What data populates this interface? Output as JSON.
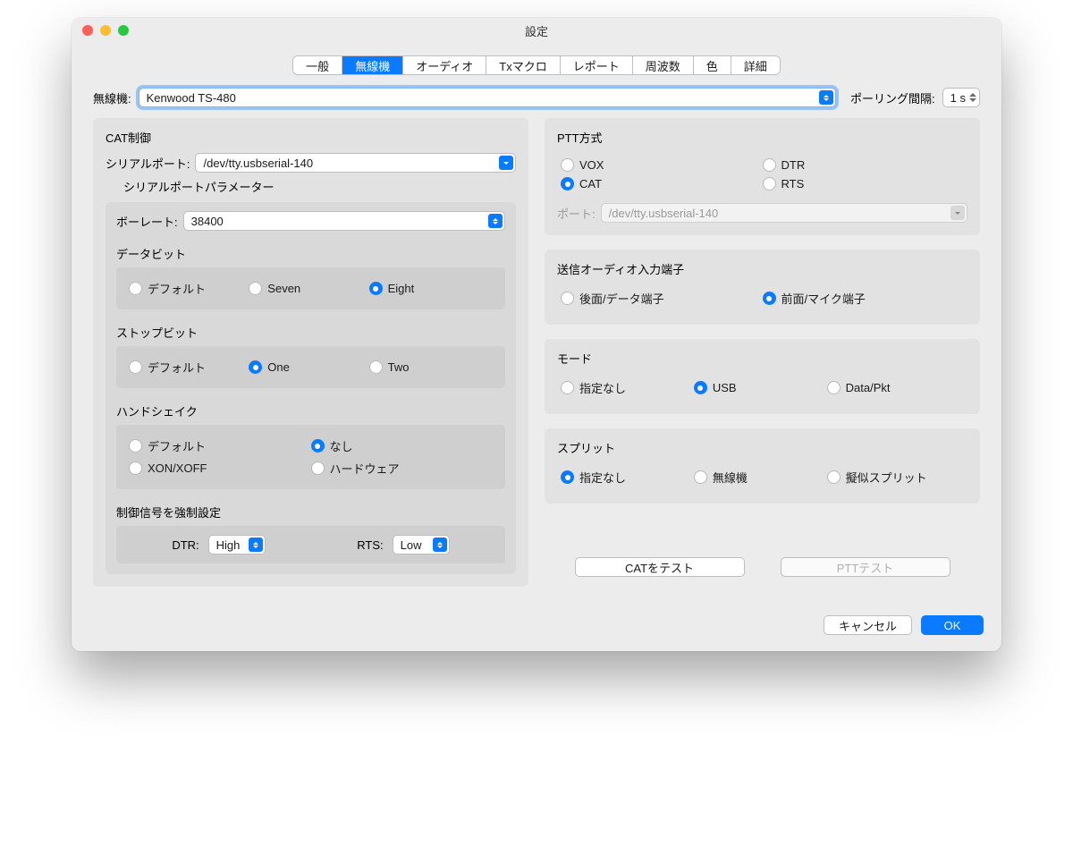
{
  "window_title": "設定",
  "tabs": [
    "一般",
    "無線機",
    "オーディオ",
    "Txマクロ",
    "レポート",
    "周波数",
    "色",
    "詳細"
  ],
  "active_tab": "無線機",
  "rig_label": "無線機:",
  "rig_value": "Kenwood TS-480",
  "poll_label": "ポーリング間隔:",
  "poll_value": "1 s",
  "cat": {
    "title": "CAT制御",
    "serial_label": "シリアルポート:",
    "serial_value": "/dev/tty.usbserial-140",
    "params_title": "シリアルポートパラメーター",
    "baud_label": "ボーレート:",
    "baud_value": "38400",
    "databits_title": "データビット",
    "databits": [
      "デフォルト",
      "Seven",
      "Eight"
    ],
    "databits_sel": "Eight",
    "stopbits_title": "ストップビット",
    "stopbits": [
      "デフォルト",
      "One",
      "Two"
    ],
    "stopbits_sel": "One",
    "handshake_title": "ハンドシェイク",
    "handshake": [
      "デフォルト",
      "なし",
      "XON/XOFF",
      "ハードウェア"
    ],
    "handshake_sel": "なし",
    "force_title": "制御信号を強制設定",
    "dtr_label": "DTR:",
    "dtr_value": "High",
    "rts_label": "RTS:",
    "rts_value": "Low"
  },
  "ptt": {
    "title": "PTT方式",
    "options": [
      "VOX",
      "CAT",
      "DTR",
      "RTS"
    ],
    "selected": "CAT",
    "port_label": "ポート:",
    "port_value": "/dev/tty.usbserial-140"
  },
  "txaudio": {
    "title": "送信オーディオ入力端子",
    "options": [
      "後面/データ端子",
      "前面/マイク端子"
    ],
    "selected": "前面/マイク端子"
  },
  "mode": {
    "title": "モード",
    "options": [
      "指定なし",
      "USB",
      "Data/Pkt"
    ],
    "selected": "USB"
  },
  "split": {
    "title": "スプリット",
    "options": [
      "指定なし",
      "無線機",
      "擬似スプリット"
    ],
    "selected": "指定なし"
  },
  "buttons": {
    "cat_test": "CATをテスト",
    "ptt_test": "PTTテスト",
    "cancel": "キャンセル",
    "ok": "OK"
  }
}
